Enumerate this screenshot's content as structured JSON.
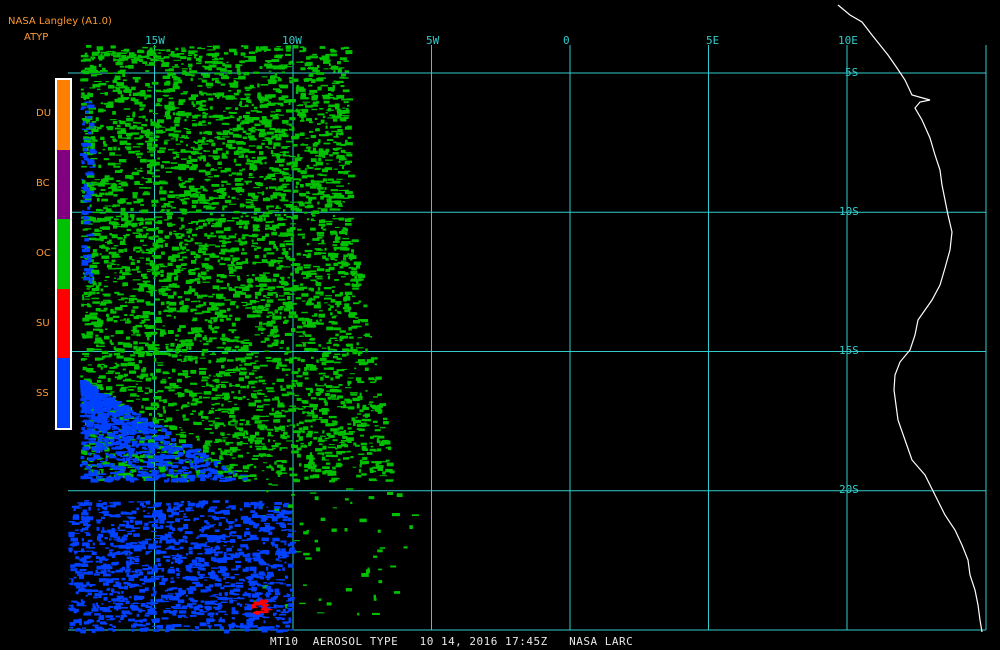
{
  "header": {
    "source": "NASA Langley (A1.0)",
    "product": "ATYP"
  },
  "legend": [
    {
      "code": "DU",
      "color": "#ff8000"
    },
    {
      "code": "BC",
      "color": "#800080"
    },
    {
      "code": "OC",
      "color": "#00c000"
    },
    {
      "code": "SU",
      "color": "#ff0000"
    },
    {
      "code": "SS",
      "color": "#0040ff"
    }
  ],
  "grid": {
    "longitudes": [
      {
        "label": "15W",
        "lon": -15
      },
      {
        "label": "10W",
        "lon": -10
      },
      {
        "label": "5W",
        "lon": -5
      },
      {
        "label": "0",
        "lon": 0
      },
      {
        "label": "5E",
        "lon": 5
      },
      {
        "label": "10E",
        "lon": 10
      }
    ],
    "latitudes": [
      {
        "label": "5S",
        "lat": -5
      },
      {
        "label": "10S",
        "lat": -10
      },
      {
        "label": "15S",
        "lat": -15
      },
      {
        "label": "20S",
        "lat": -20
      }
    ],
    "color": "#33cccc"
  },
  "coastline_color": "#ffffff",
  "footer": "MT10  AEROSOL TYPE   10 14, 2016 17:45Z   NASA LARC"
}
